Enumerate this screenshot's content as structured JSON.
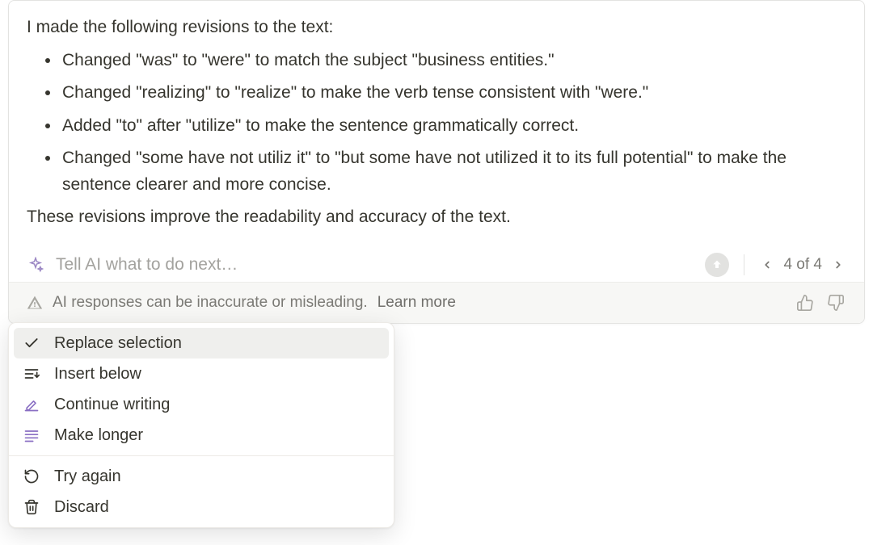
{
  "response": {
    "intro": "I made the following revisions to the text:",
    "bullets": [
      "Changed \"was\" to \"were\" to match the subject \"business entities.\"",
      "Changed \"realizing\" to \"realize\" to make the verb tense consistent with \"were.\"",
      "Added \"to\" after \"utilize\" to make the sentence grammatically correct.",
      "Changed \"some have not utiliz it\" to \"but some have not utilized it to its full potential\" to make the sentence clearer and more concise."
    ],
    "outro": "These revisions improve the readability and accuracy of the text."
  },
  "input": {
    "placeholder": "Tell AI what to do next…"
  },
  "pager": {
    "label": "4 of 4"
  },
  "footer": {
    "disclaimer": "AI responses can be inaccurate or misleading.",
    "learn_more": "Learn more"
  },
  "menu": {
    "items": [
      {
        "label": "Replace selection"
      },
      {
        "label": "Insert below"
      },
      {
        "label": "Continue writing"
      },
      {
        "label": "Make longer"
      },
      {
        "label": "Try again"
      },
      {
        "label": "Discard"
      }
    ]
  }
}
